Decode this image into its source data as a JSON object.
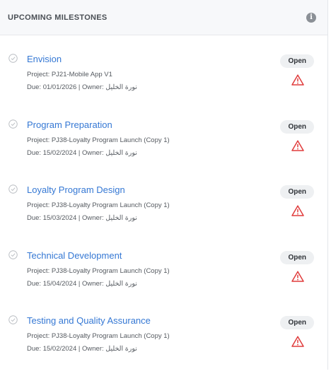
{
  "header": {
    "title": "UPCOMING MILESTONES",
    "info_icon": "i"
  },
  "milestones": [
    {
      "title": "Envision",
      "project": "Project: PJ21-Mobile App V1",
      "due": "Due: 01/01/2026 | Owner: نورة الخليل",
      "status": "Open"
    },
    {
      "title": "Program Preparation",
      "project": "Project: PJ38-Loyalty Program Launch (Copy 1)",
      "due": "Due: 15/02/2024 | Owner: نورة الخليل",
      "status": "Open"
    },
    {
      "title": "Loyalty Program Design",
      "project": "Project: PJ38-Loyalty Program Launch (Copy 1)",
      "due": "Due: 15/03/2024 | Owner: نورة الخليل",
      "status": "Open"
    },
    {
      "title": "Technical Development",
      "project": "Project: PJ38-Loyalty Program Launch (Copy 1)",
      "due": "Due: 15/04/2024 | Owner: نورة الخليل",
      "status": "Open"
    },
    {
      "title": "Testing and Quality Assurance",
      "project": "Project: PJ38-Loyalty Program Launch (Copy 1)",
      "due": "Due: 15/02/2024 | Owner: نورة الخليل",
      "status": "Open"
    }
  ],
  "colors": {
    "link": "#3578d4",
    "alert": "#e03b3b",
    "badge_bg": "#eef0f2"
  }
}
